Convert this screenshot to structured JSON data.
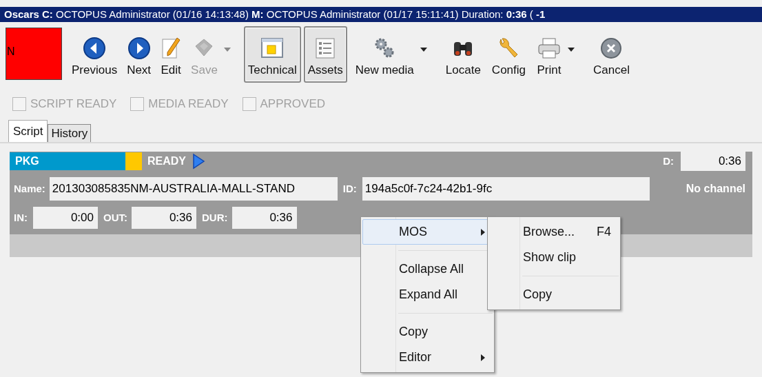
{
  "title_bar": {
    "text": "**Oscars C:** OCTOPUS Administrator (01/16 14:13:48) **M:** OCTOPUS Administrator (01/17 15:11:41) Duration: **0:36** ( **-1**"
  },
  "status_tile": {
    "label": "N"
  },
  "toolbar": [
    {
      "label": "Previous",
      "disabled": false,
      "pressed": false,
      "has_menu": false
    },
    {
      "label": "Next",
      "disabled": false,
      "pressed": false,
      "has_menu": false
    },
    {
      "label": "Edit",
      "disabled": false,
      "pressed": false,
      "has_menu": false
    },
    {
      "label": "Save",
      "disabled": true,
      "pressed": false,
      "has_menu": true
    },
    {
      "label": "Technical",
      "disabled": false,
      "pressed": true,
      "has_menu": false
    },
    {
      "label": "Assets",
      "disabled": false,
      "pressed": true,
      "has_menu": false
    },
    {
      "label": "New media",
      "disabled": false,
      "pressed": false,
      "has_menu": true
    },
    {
      "label": "Locate",
      "disabled": false,
      "pressed": false,
      "has_menu": false
    },
    {
      "label": "Config",
      "disabled": false,
      "pressed": false,
      "has_menu": false
    },
    {
      "label": "Print",
      "disabled": false,
      "pressed": false,
      "has_menu": true
    },
    {
      "label": "Cancel",
      "disabled": false,
      "pressed": false,
      "has_menu": false
    }
  ],
  "checkboxes": [
    {
      "label": "SCRIPT READY",
      "checked": false,
      "disabled": true
    },
    {
      "label": "MEDIA READY",
      "checked": false,
      "disabled": true
    },
    {
      "label": "APPROVED",
      "checked": false,
      "disabled": true
    }
  ],
  "tabs": [
    {
      "label": "Script",
      "selected": true
    },
    {
      "label": "History",
      "selected": false
    }
  ],
  "story": {
    "type": "PKG",
    "status": "READY",
    "duration_label": "D:",
    "duration": "0:36",
    "name_label": "Name:",
    "name": "201303085835NM-AUSTRALIA-MALL-STAND",
    "id_label": "ID:",
    "id": "194a5c0f-7c24-42b1-9fc",
    "channel": "No channel",
    "timing": [
      {
        "label": "IN:",
        "value": "0:00"
      },
      {
        "label": "OUT:",
        "value": "0:36"
      },
      {
        "label": "DUR:",
        "value": "0:36"
      }
    ]
  },
  "context_menu": {
    "items": [
      {
        "kind": "item",
        "label": "MOS",
        "submenu": true,
        "highlighted": true
      },
      {
        "kind": "separator"
      },
      {
        "kind": "item",
        "label": "Collapse All",
        "submenu": false,
        "highlighted": false
      },
      {
        "kind": "item",
        "label": "Expand All",
        "submenu": false,
        "highlighted": false
      },
      {
        "kind": "separator"
      },
      {
        "kind": "item",
        "label": "Copy",
        "submenu": false,
        "highlighted": false
      },
      {
        "kind": "item",
        "label": "Editor",
        "submenu": true,
        "highlighted": false
      }
    ],
    "submenu": [
      {
        "kind": "item",
        "label": "Browse...",
        "shortcut": "F4"
      },
      {
        "kind": "item",
        "label": "Show clip"
      },
      {
        "kind": "separator"
      },
      {
        "kind": "item",
        "label": "Copy"
      }
    ]
  }
}
